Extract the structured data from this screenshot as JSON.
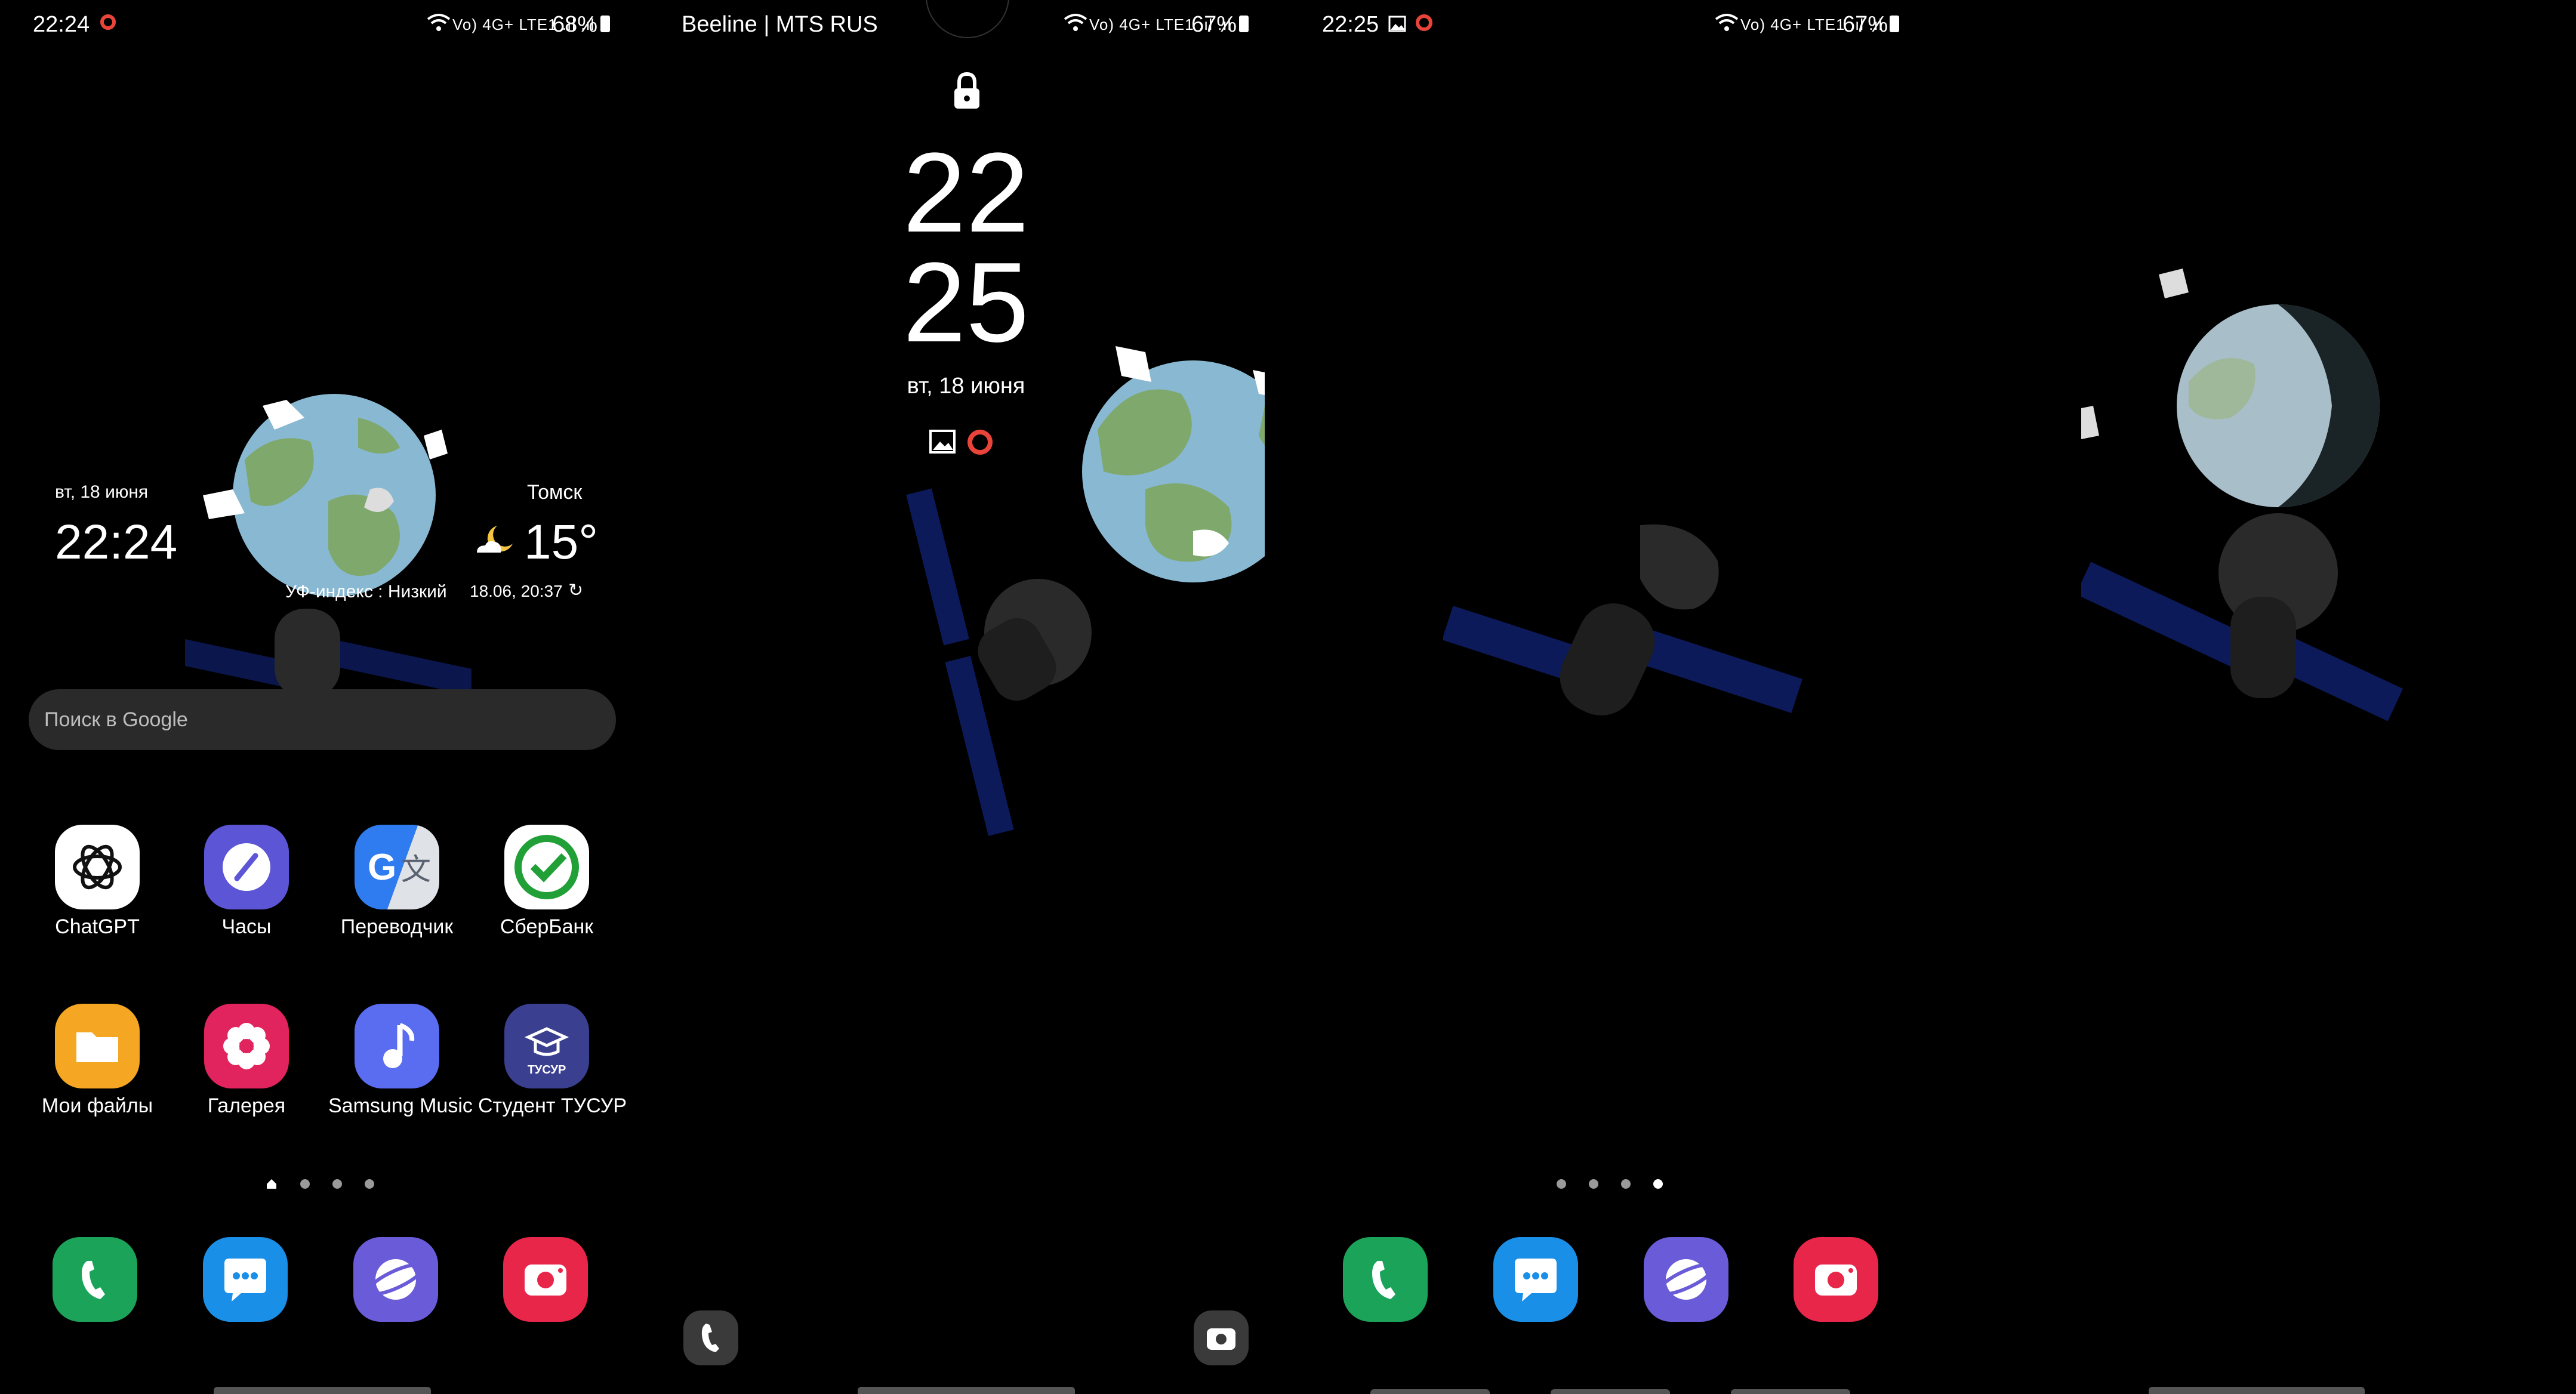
{
  "screen1": {
    "status_time": "22:24",
    "status_network": "Vo) 4G+ LTE1 .ıl .ıl",
    "battery": "68%",
    "widget_date": "вт, 18 июня",
    "widget_time": "22:24",
    "weather_city": "Томск",
    "weather_temp": "15°",
    "uv_index": "УФ-индекс : Низкий",
    "weather_updated": "18.06, 20:37",
    "search_placeholder": "Поиск в Google",
    "apps": [
      {
        "label": "ChatGPT"
      },
      {
        "label": "Часы"
      },
      {
        "label": "Переводчик"
      },
      {
        "label": "СберБанк"
      },
      {
        "label": "Мои файлы"
      },
      {
        "label": "Галерея"
      },
      {
        "label": "Samsung Music"
      },
      {
        "label": "Студент ТУСУР"
      }
    ],
    "tusur_badge": "ТУСУР",
    "page_indicator": {
      "pages": 4,
      "current": 1
    }
  },
  "screen2": {
    "carrier": "Beeline | MTS RUS",
    "status_network": "Vo) 4G+ LTE1 .ıl .ıl",
    "battery": "67%",
    "clock_hour": "22",
    "clock_minute": "25",
    "date": "вт, 18 июня"
  },
  "screen3": {
    "status_time": "22:25",
    "status_network": "Vo) 4G+ LTE1 .ıl .ıl",
    "battery": "67%",
    "page_indicator": {
      "pages": 4,
      "current": 4
    }
  },
  "colors": {
    "phone_green": "#1ba35a",
    "messages_blue": "#1a8fe8",
    "internet_purple": "#6a5bd8",
    "camera_red": "#e8264a",
    "sber_green": "#21a038",
    "files_orange": "#f5a623",
    "gallery_pink": "#e1245d",
    "music_blue": "#5a6cf0",
    "tusur_navy": "#3b3f8f",
    "clock_purple": "#5c55d6",
    "recording_red": "#e8443a"
  }
}
